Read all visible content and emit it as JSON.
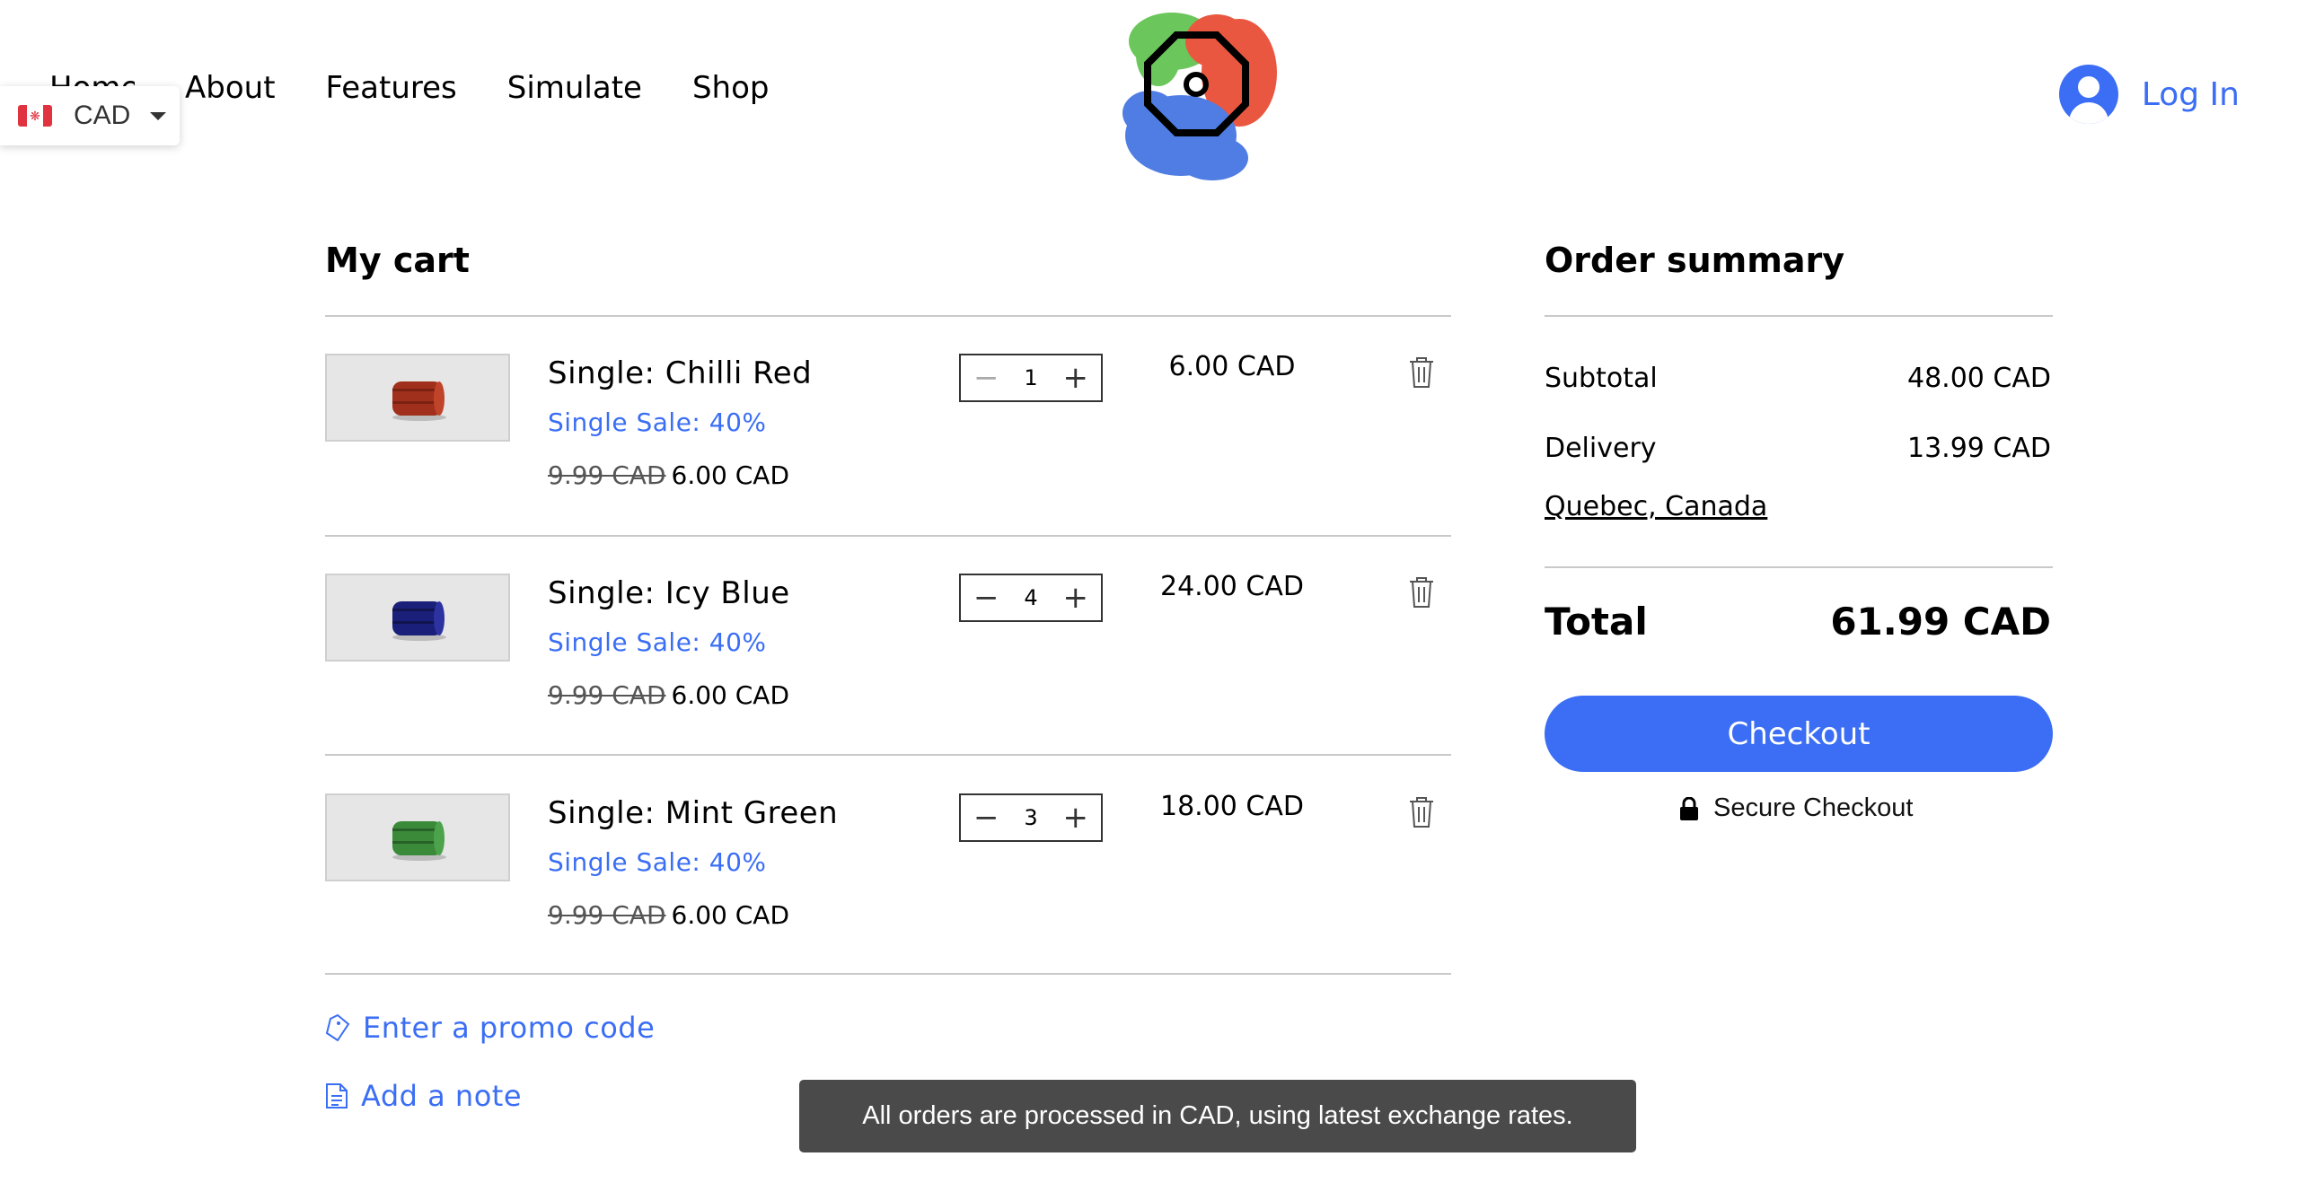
{
  "nav": {
    "items": [
      "Home",
      "About",
      "Features",
      "Simulate",
      "Shop"
    ]
  },
  "currency": {
    "selected": "CAD",
    "flag": "canada-flag-icon"
  },
  "header": {
    "login_label": "Log In"
  },
  "cart": {
    "title": "My cart",
    "items": [
      {
        "name": "Single: Chilli Red",
        "sale": "Single Sale: 40%",
        "old_price": "9.99 CAD",
        "price": "6.00 CAD",
        "quantity": "1",
        "total": "6.00 CAD",
        "color": "#a0301c"
      },
      {
        "name": "Single: Icy Blue",
        "sale": "Single Sale: 40%",
        "old_price": "9.99 CAD",
        "price": "6.00 CAD",
        "quantity": "4",
        "total": "24.00 CAD",
        "color": "#1a1f7a"
      },
      {
        "name": "Single: Mint Green",
        "sale": "Single Sale: 40%",
        "old_price": "9.99 CAD",
        "price": "6.00 CAD",
        "quantity": "3",
        "total": "18.00 CAD",
        "color": "#3a8a3a"
      }
    ],
    "promo_label": "Enter a promo code",
    "note_label": "Add a note"
  },
  "summary": {
    "title": "Order summary",
    "subtotal_label": "Subtotal",
    "subtotal_value": "48.00 CAD",
    "delivery_label": "Delivery",
    "delivery_value": "13.99 CAD",
    "location": "Quebec, Canada",
    "total_label": "Total",
    "total_value": "61.99 CAD",
    "checkout_label": "Checkout",
    "secure_label": "Secure Checkout"
  },
  "toast": {
    "message": "All orders are processed in CAD, using latest exchange rates."
  },
  "colors": {
    "accent": "#3b6ef5",
    "toast_bg": "#4a4a4a"
  }
}
